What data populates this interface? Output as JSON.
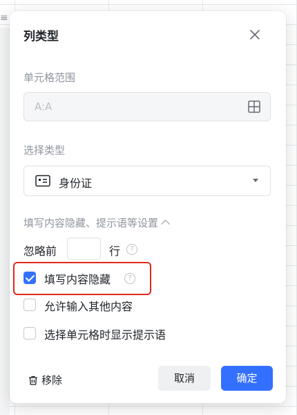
{
  "dialog": {
    "title": "列类型",
    "cell_range_label": "单元格范围",
    "cell_range_value": "A:A",
    "type_label": "选择类型",
    "type_value": "身份证",
    "settings_toggle": "填写内容隐藏、提示语等设置",
    "ignore_prefix": "忽略前",
    "ignore_value": "",
    "ignore_suffix": "行",
    "help_glyph": "?",
    "options": [
      {
        "label": "填写内容隐藏",
        "checked": true
      },
      {
        "label": "允许输入其他内容",
        "checked": false
      },
      {
        "label": "选择单元格时显示提示语",
        "checked": false
      }
    ],
    "remove_label": "移除",
    "cancel_label": "取消",
    "confirm_label": "确定"
  },
  "colors": {
    "primary": "#3370ff",
    "highlight": "#e0281a"
  }
}
